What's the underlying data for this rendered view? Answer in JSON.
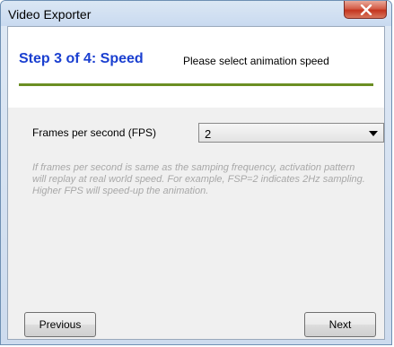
{
  "window": {
    "title": "Video Exporter",
    "close_icon": "close-icon"
  },
  "header": {
    "step_title": "Step 3 of 4: Speed",
    "step_description": "Please select animation speed",
    "rule_color": "#6b8e23",
    "title_color": "#1a3fd0"
  },
  "form": {
    "fps_label": "Frames per second (FPS)",
    "fps_value": "2",
    "help_text": "If frames per second is same as the samping frequency, activation pattern will replay at real world speed. For example, FSP=2 indicates 2Hz sampling. Higher FPS will speed-up the animation."
  },
  "buttons": {
    "previous_label": "Previous",
    "next_label": "Next"
  }
}
